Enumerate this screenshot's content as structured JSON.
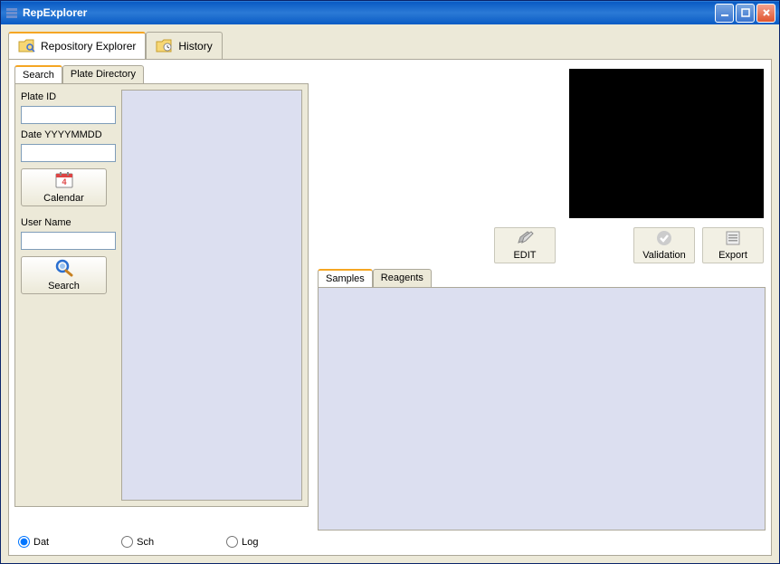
{
  "window": {
    "title": "RepExplorer"
  },
  "topTabs": {
    "repository": "Repository Explorer",
    "history": "History"
  },
  "subTabs": {
    "search": "Search",
    "plateDirectory": "Plate Directory"
  },
  "searchForm": {
    "plateIdLabel": "Plate ID",
    "dateLabel": "Date YYYYMMDD",
    "calendarBtn": "Calendar",
    "userNameLabel": "User Name",
    "searchBtn": "Search"
  },
  "actions": {
    "edit": "EDIT",
    "validation": "Validation",
    "export": "Export"
  },
  "detailTabs": {
    "samples": "Samples",
    "reagents": "Reagents"
  },
  "radios": {
    "dat": "Dat",
    "sch": "Sch",
    "log": "Log"
  }
}
